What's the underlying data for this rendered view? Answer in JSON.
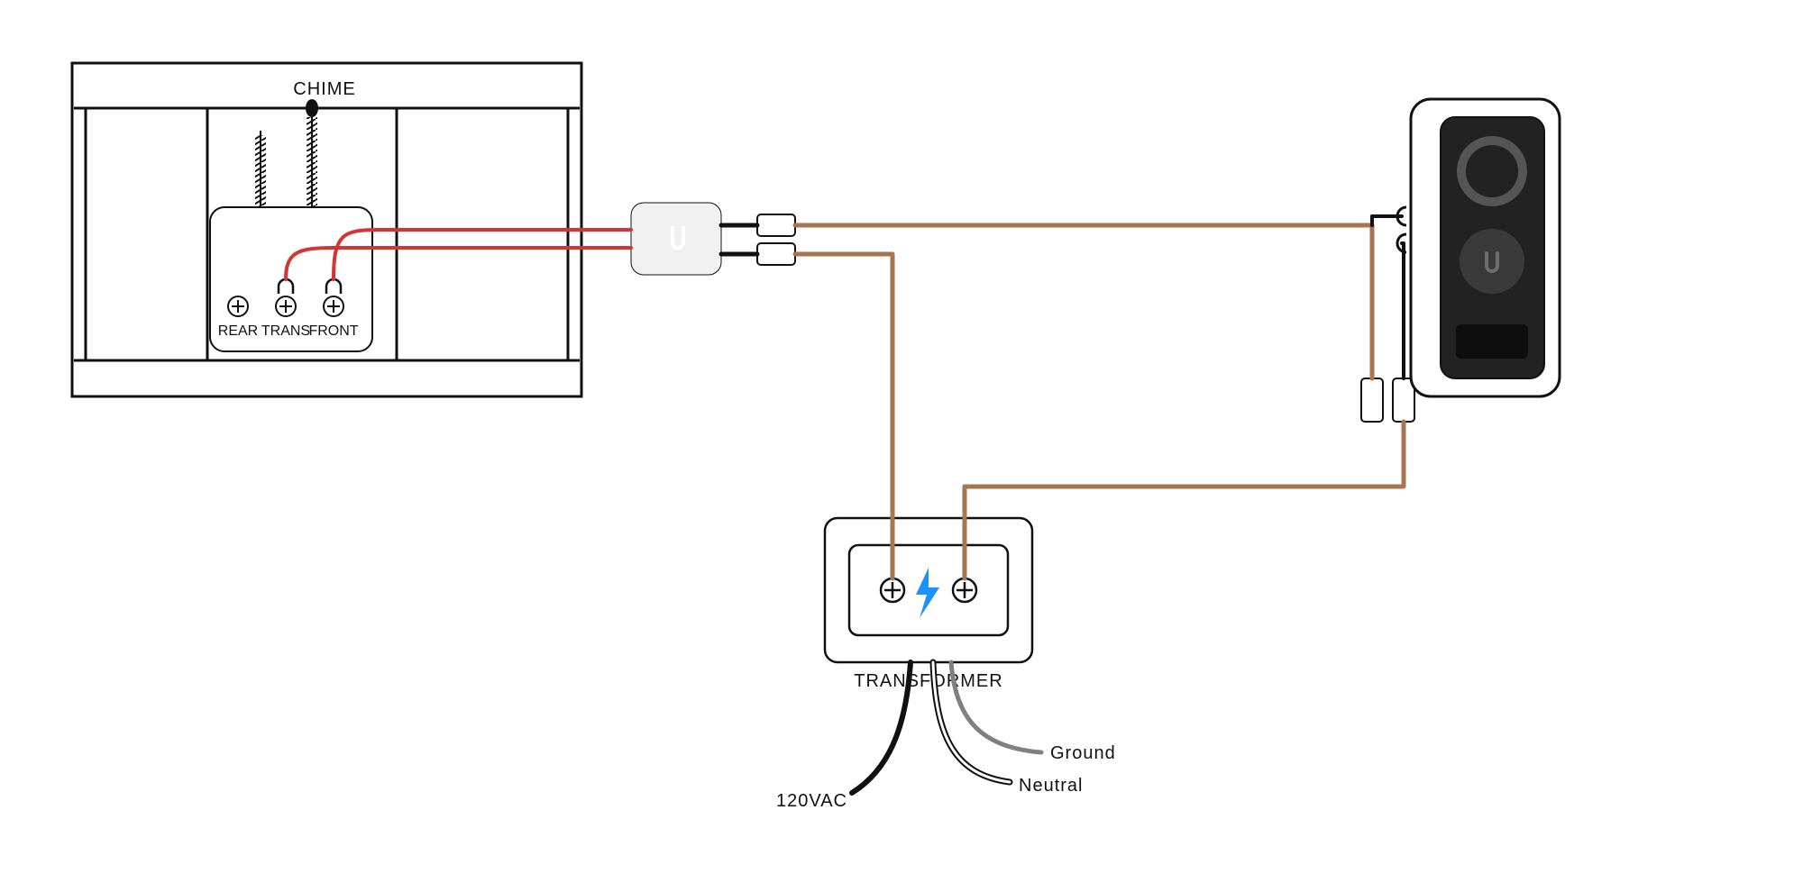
{
  "chime": {
    "title": "CHIME",
    "terminals": {
      "rear": "REAR",
      "trans": "TRANS",
      "front": "FRONT"
    }
  },
  "transformer": {
    "title": "TRANSFORMER",
    "wires": {
      "hot": "120VAC",
      "neutral": "Neutral",
      "ground": "Ground"
    }
  },
  "colors": {
    "redWire": "#d33434",
    "copperWire": "#a7754f",
    "blackWire": "#111111",
    "whiteWire": "#ffffff",
    "grayWire": "#808080",
    "bolt": "#1e90ff",
    "outline": "#111111",
    "dark": "#222222",
    "adapterFill": "#f1f1f1"
  }
}
